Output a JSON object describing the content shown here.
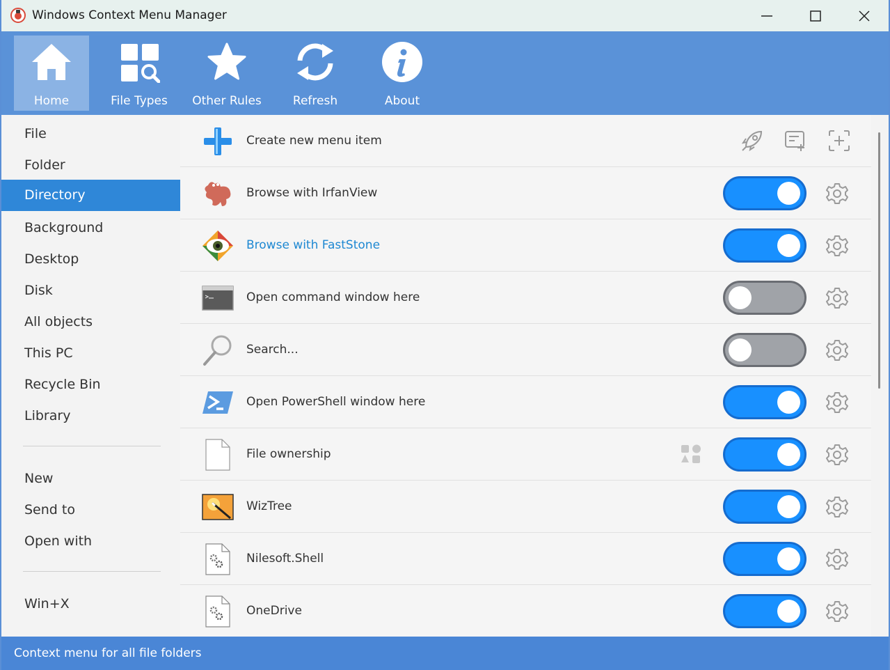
{
  "window": {
    "title": "Windows Context Menu Manager"
  },
  "toolbar": {
    "items": [
      {
        "label": "Home",
        "icon": "home-icon",
        "active": true
      },
      {
        "label": "File Types",
        "icon": "file-types-icon"
      },
      {
        "label": "Other Rules",
        "icon": "star-icon"
      },
      {
        "label": "Refresh",
        "icon": "refresh-icon"
      },
      {
        "label": "About",
        "icon": "info-icon"
      }
    ]
  },
  "sidebar": {
    "items": [
      {
        "label": "File"
      },
      {
        "label": "Folder"
      },
      {
        "label": "Directory",
        "selected": true
      },
      {
        "label": "Background"
      },
      {
        "label": "Desktop"
      },
      {
        "label": "Disk"
      },
      {
        "label": "All objects"
      },
      {
        "label": "This PC"
      },
      {
        "label": "Recycle Bin"
      },
      {
        "label": "Library"
      },
      {
        "label": "New"
      },
      {
        "label": "Send to"
      },
      {
        "label": "Open with"
      },
      {
        "label": "Win+X"
      }
    ]
  },
  "list": {
    "create_label": "Create new menu item",
    "rows": [
      {
        "label": "Browse with IrfanView",
        "enabled": true
      },
      {
        "label": "Browse with FastStone",
        "enabled": true,
        "highlighted": true
      },
      {
        "label": "Open command window here",
        "enabled": false
      },
      {
        "label": "Search...",
        "enabled": false
      },
      {
        "label": "Open PowerShell window here",
        "enabled": true
      },
      {
        "label": "File ownership",
        "enabled": true
      },
      {
        "label": "WizTree",
        "enabled": true
      },
      {
        "label": "Nilesoft.Shell",
        "enabled": true
      },
      {
        "label": "OneDrive",
        "enabled": true
      }
    ]
  },
  "status": {
    "text": "Context menu for all file folders"
  },
  "colors": {
    "accent": "#1890ff",
    "toolbar": "#5a92d8",
    "selected": "#2f87d8",
    "status": "#4a86d6"
  }
}
